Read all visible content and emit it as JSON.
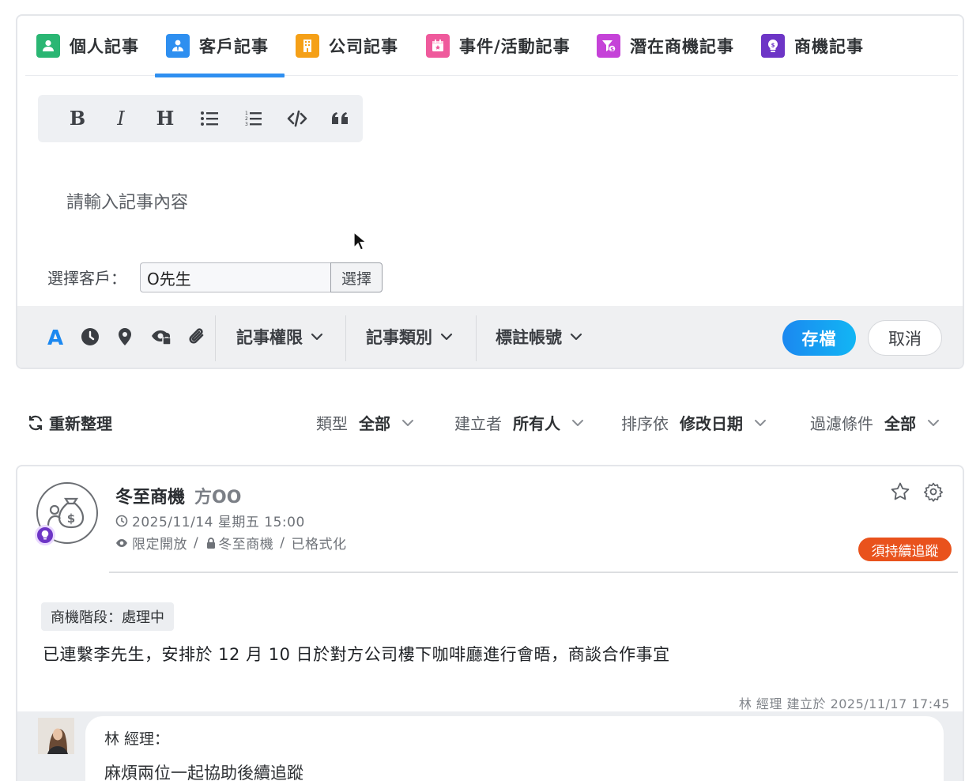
{
  "tabs": [
    {
      "label": "個人記事",
      "icon": "person-icon",
      "color": "#2ab673"
    },
    {
      "label": "客戶記事",
      "icon": "customer-icon",
      "color": "#2e8ff0"
    },
    {
      "label": "公司記事",
      "icon": "building-icon",
      "color": "#f5a017"
    },
    {
      "label": "事件/活動記事",
      "icon": "calendar-icon",
      "color": "#ef5a9c"
    },
    {
      "label": "潛在商機記事",
      "icon": "funnel-dollar-icon",
      "color": "#c542d8"
    },
    {
      "label": "商機記事",
      "icon": "lightbulb-icon",
      "color": "#6d35c6"
    }
  ],
  "active_tab": "客戶記事",
  "format_toolbar": [
    "bold-icon",
    "italic-icon",
    "heading-icon",
    "bullet-list-icon",
    "numbered-list-icon",
    "code-icon",
    "quote-icon"
  ],
  "editor": {
    "placeholder": "請輸入記事內容"
  },
  "customer": {
    "label": "選擇客戶：",
    "value": "O先生",
    "button": "選擇"
  },
  "bottom_toolbar": {
    "icons": [
      "text-color-icon",
      "clock-icon",
      "location-pin-icon",
      "private-eye-icon",
      "paperclip-icon"
    ],
    "permission": "記事權限",
    "category": "記事類別",
    "tag_account": "標註帳號",
    "save": "存檔",
    "cancel": "取消",
    "accent": "#1b88f0"
  },
  "filters": {
    "refresh": "重新整理",
    "type_label": "類型",
    "type_value": "全部",
    "creator_label": "建立者",
    "creator_value": "所有人",
    "sort_label": "排序依",
    "sort_value": "修改日期",
    "filter_label": "過濾條件",
    "filter_value": "全部"
  },
  "note": {
    "title": "冬至商機",
    "author": "方OO",
    "datetime": "2025/11/14 星期五 15:00",
    "visibility": "限定開放",
    "linked": "冬至商機",
    "format": "已格式化",
    "status_badge": "須持續追蹤",
    "status_color": "#e9521c",
    "stage": "商機階段：處理中",
    "body": "已連繫李先生，安排於 12 月 10 日於對方公司樓下咖啡廳進行會晤，商談合作事宜",
    "created": "林 經理 建立於 2025/11/17 17:45"
  },
  "comment": {
    "name": "林 經理：",
    "text": "麻煩兩位一起協助後續追蹤"
  }
}
